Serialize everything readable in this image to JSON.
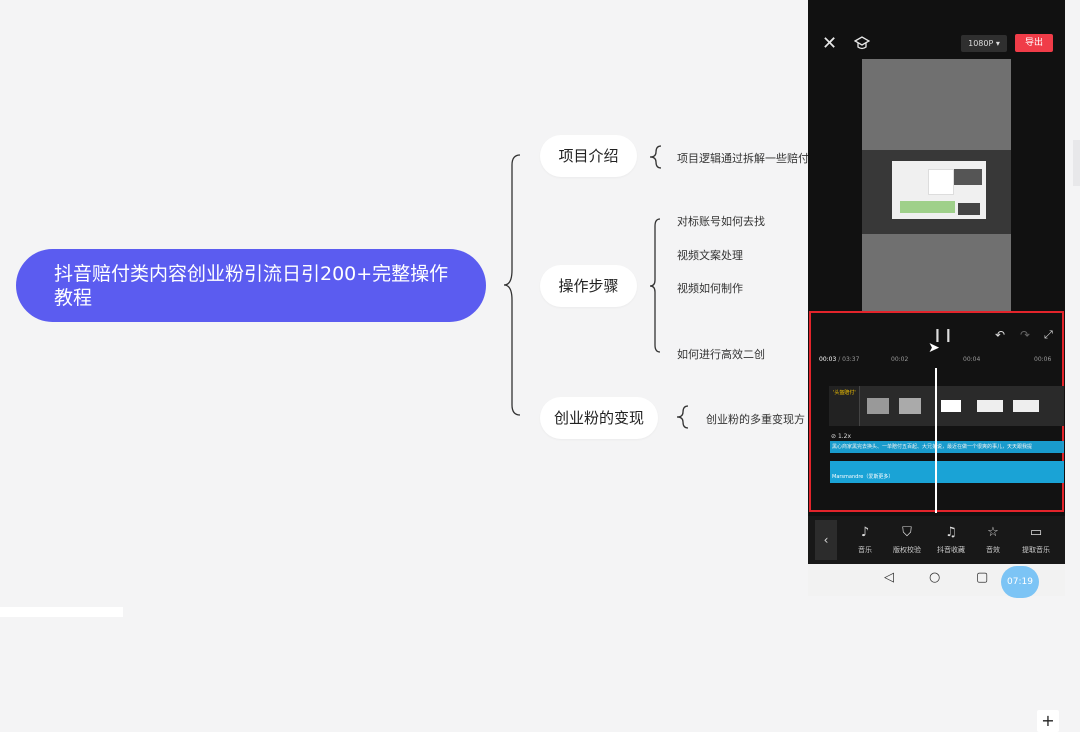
{
  "mindmap": {
    "root": "抖音赔付类内容创业粉引流日引200+完整操作教程",
    "branches": [
      {
        "label": "项目介绍",
        "children": [
          "项目逻辑通过拆解一些赔付"
        ]
      },
      {
        "label": "操作步骤",
        "children": [
          "对标账号如何去找",
          "视频文案处理",
          "视频如何制作",
          "如何进行高效二创"
        ]
      },
      {
        "label": "创业粉的变现",
        "children": [
          "创业粉的多重变现方"
        ]
      }
    ]
  },
  "editor": {
    "resolution": "1080P ▾",
    "export_label": "导出",
    "time_current": "00:03",
    "time_total": " / 03:37",
    "ticks": [
      "00:02",
      "00:04",
      "00:06"
    ],
    "speed_label": "1.2x",
    "clip_caption": "'头盔赔付'",
    "caption_track": "黑心商家黑完去换头、一单赔付五百起、大兄弟说，最近在做一个很爽的事儿，天天跟我提",
    "music_track": "Marsmandre（爱斯更多）",
    "tools": [
      {
        "icon": "music-icon",
        "label": "音乐"
      },
      {
        "icon": "copyright-check-icon",
        "label": "版权校验"
      },
      {
        "icon": "douyin-icon",
        "label": "抖音收藏"
      },
      {
        "icon": "sound-effect-icon",
        "label": "音效"
      },
      {
        "icon": "extract-music-icon",
        "label": "提取音乐"
      }
    ]
  },
  "recording_time": "07:19",
  "colors": {
    "root_node": "#5b5cf0",
    "export_button": "#f03c48",
    "highlight_border": "#e3242b",
    "waveform": "#1aa3d6"
  }
}
